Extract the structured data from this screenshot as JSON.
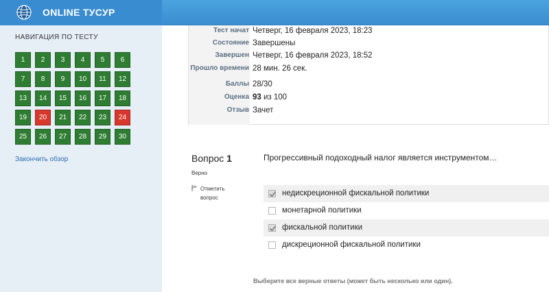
{
  "header": {
    "brand": "ONLINE ТУСУР"
  },
  "sidebar": {
    "title": "НАВИГАЦИЯ ПО ТЕСТУ",
    "questions": [
      {
        "n": "1",
        "state": "correct"
      },
      {
        "n": "2",
        "state": "correct"
      },
      {
        "n": "3",
        "state": "correct"
      },
      {
        "n": "4",
        "state": "correct"
      },
      {
        "n": "5",
        "state": "correct"
      },
      {
        "n": "6",
        "state": "correct"
      },
      {
        "n": "7",
        "state": "correct"
      },
      {
        "n": "8",
        "state": "correct"
      },
      {
        "n": "9",
        "state": "correct"
      },
      {
        "n": "10",
        "state": "correct"
      },
      {
        "n": "11",
        "state": "correct"
      },
      {
        "n": "12",
        "state": "correct"
      },
      {
        "n": "13",
        "state": "correct"
      },
      {
        "n": "14",
        "state": "correct"
      },
      {
        "n": "15",
        "state": "correct"
      },
      {
        "n": "16",
        "state": "correct"
      },
      {
        "n": "17",
        "state": "correct"
      },
      {
        "n": "18",
        "state": "correct"
      },
      {
        "n": "19",
        "state": "correct"
      },
      {
        "n": "20",
        "state": "wrong"
      },
      {
        "n": "21",
        "state": "correct"
      },
      {
        "n": "22",
        "state": "correct"
      },
      {
        "n": "23",
        "state": "correct"
      },
      {
        "n": "24",
        "state": "wrong"
      },
      {
        "n": "25",
        "state": "correct"
      },
      {
        "n": "26",
        "state": "correct"
      },
      {
        "n": "27",
        "state": "correct"
      },
      {
        "n": "28",
        "state": "correct"
      },
      {
        "n": "29",
        "state": "correct"
      },
      {
        "n": "30",
        "state": "correct"
      }
    ],
    "finish_link": "Закончить обзор"
  },
  "summary": {
    "rows": [
      {
        "label": "Тест начат",
        "value": "Четверг, 16 февраля 2023, 18:23"
      },
      {
        "label": "Состояние",
        "value": "Завершены"
      },
      {
        "label": "Завершен",
        "value": "Четверг, 16 февраля 2023, 18:52"
      },
      {
        "label": "Прошло времени",
        "value": "28 мин. 26 сек."
      },
      {
        "label": "Баллы",
        "value": "28/30"
      },
      {
        "label": "Оценка",
        "value_bold": "93",
        "value": "из 100"
      },
      {
        "label": "Отзыв",
        "value": "Зачет"
      }
    ]
  },
  "question": {
    "prefix": "Вопрос",
    "number": "1",
    "state": "Верно",
    "flag_label": "Отметить вопрос",
    "text": "Прогрессивный подоходный налог является инструментом…",
    "answers": [
      {
        "label": "недискреционной фискальной политики",
        "checked": true
      },
      {
        "label": "монетарной политики",
        "checked": false
      },
      {
        "label": "фискальной политики",
        "checked": true
      },
      {
        "label": "дискреционной фискальной политики",
        "checked": false
      }
    ],
    "hint": "Выберите все верные ответы (может быть несколько или один)."
  },
  "colors": {
    "correct": "#2e7d32",
    "wrong": "#d6382e",
    "header": "#3b8ed0",
    "sidebar": "#e6eef6"
  }
}
